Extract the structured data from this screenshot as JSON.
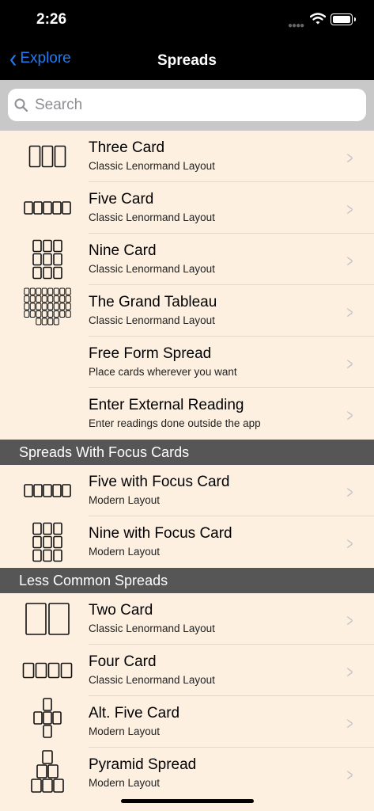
{
  "status": {
    "time": "2:26"
  },
  "nav": {
    "back_label": "Explore",
    "title": "Spreads"
  },
  "search": {
    "placeholder": "Search"
  },
  "sections": [
    {
      "header": "",
      "rows": [
        {
          "title": "Three Card",
          "subtitle": "Classic Lenormand Layout",
          "icon": "three-card-icon"
        },
        {
          "title": "Five Card",
          "subtitle": "Classic Lenormand Layout",
          "icon": "five-card-icon"
        },
        {
          "title": "Nine Card",
          "subtitle": "Classic Lenormand Layout",
          "icon": "nine-card-icon"
        },
        {
          "title": "The Grand Tableau",
          "subtitle": "Classic Lenormand Layout",
          "icon": "grand-tableau-icon"
        },
        {
          "title": "Free Form Spread",
          "subtitle": "Place cards wherever you want",
          "icon": ""
        },
        {
          "title": "Enter External Reading",
          "subtitle": "Enter readings done outside the app",
          "icon": ""
        }
      ]
    },
    {
      "header": "Spreads With Focus Cards",
      "rows": [
        {
          "title": "Five with Focus Card",
          "subtitle": "Modern Layout",
          "icon": "five-card-icon"
        },
        {
          "title": "Nine with Focus Card",
          "subtitle": "Modern Layout",
          "icon": "nine-card-icon"
        }
      ]
    },
    {
      "header": "Less Common Spreads",
      "rows": [
        {
          "title": "Two Card",
          "subtitle": "Classic Lenormand Layout",
          "icon": "two-card-icon"
        },
        {
          "title": "Four Card",
          "subtitle": "Classic Lenormand Layout",
          "icon": "four-card-icon"
        },
        {
          "title": "Alt. Five Card",
          "subtitle": "Modern Layout",
          "icon": "cross-five-card-icon"
        },
        {
          "title": "Pyramid Spread",
          "subtitle": "Modern Layout",
          "icon": "pyramid-icon"
        }
      ]
    }
  ]
}
